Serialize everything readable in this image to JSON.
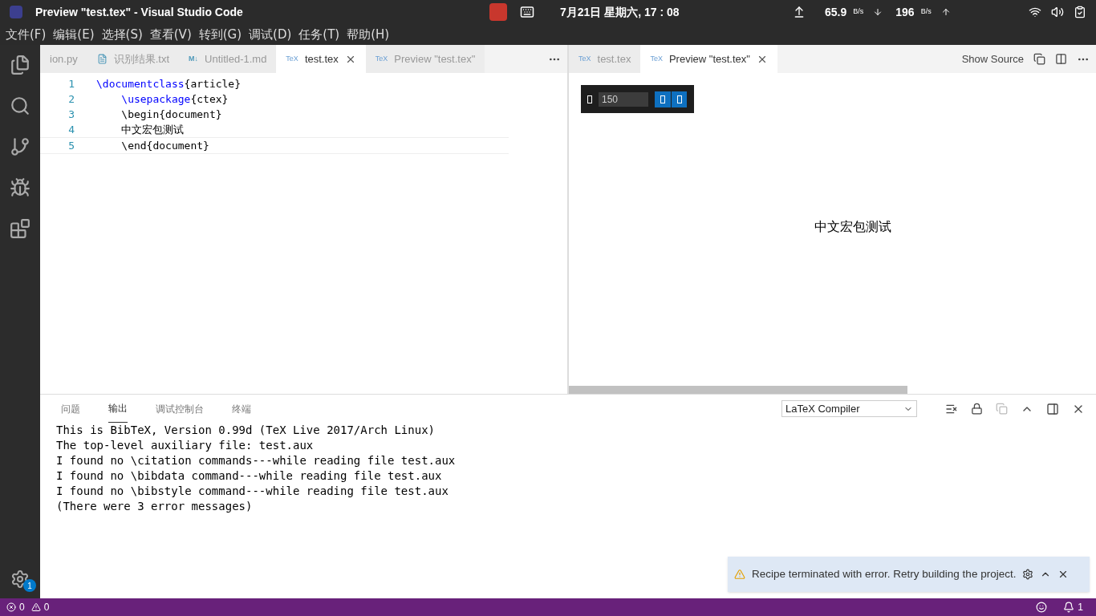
{
  "top_bar": {
    "title": "Preview \"test.tex\" - Visual Studio Code",
    "date": "7月21日 星期六, 17 : 08",
    "upload_speed": "65.9",
    "upload_unit": "B/s",
    "download_speed": "196",
    "download_unit": "B/s"
  },
  "menu": [
    "文件(F)",
    "编辑(E)",
    "选择(S)",
    "查看(V)",
    "转到(G)",
    "调试(D)",
    "任务(T)",
    "帮助(H)"
  ],
  "activity_bar": {
    "badge": "1"
  },
  "left_tabs": [
    {
      "label": "ion.py",
      "kind": "py",
      "selected": false,
      "close": false
    },
    {
      "label": "识别结果.txt",
      "kind": "txt",
      "selected": false,
      "close": false
    },
    {
      "label": "Untitled-1.md",
      "kind": "md",
      "icon": "M↓",
      "selected": false,
      "close": false
    },
    {
      "label": "test.tex",
      "kind": "tex",
      "icon": "TeX",
      "selected": true,
      "close": true
    },
    {
      "label": "Preview \"test.tex\"",
      "kind": "tex",
      "icon": "TeX",
      "selected": false,
      "close": false
    }
  ],
  "right_tabs": [
    {
      "label": "test.tex",
      "kind": "tex",
      "icon": "TeX",
      "selected": false,
      "close": false
    },
    {
      "label": "Preview \"test.tex\"",
      "kind": "tex",
      "icon": "TeX",
      "selected": true,
      "close": true
    }
  ],
  "show_source": "Show Source",
  "editor_lines": [
    {
      "number": "1",
      "parts": [
        {
          "text": "\\documentclass",
          "kind": "command"
        },
        {
          "text": "{article}",
          "kind": "plain"
        }
      ]
    },
    {
      "number": "2",
      "parts": [
        {
          "text": "    \\usepackage",
          "kind": "command"
        },
        {
          "text": "{ctex}",
          "kind": "plain"
        }
      ]
    },
    {
      "number": "3",
      "parts": [
        {
          "text": "    \\begin{document}",
          "kind": "plain"
        }
      ]
    },
    {
      "number": "4",
      "parts": [
        {
          "text": "    中文宏包测试",
          "kind": "plain"
        }
      ]
    },
    {
      "number": "5",
      "parts": [
        {
          "text": "    \\end{document}",
          "kind": "plain"
        }
      ]
    }
  ],
  "preview": {
    "zoom": "150",
    "text": "中文宏包测试"
  },
  "panel": {
    "tabs": [
      {
        "label": "问题",
        "selected": false
      },
      {
        "label": "输出",
        "selected": true
      },
      {
        "label": "调试控制台",
        "selected": false
      },
      {
        "label": "终端",
        "selected": false
      }
    ],
    "channel": "LaTeX Compiler",
    "output": [
      "This is BibTeX, Version 0.99d (TeX Live 2017/Arch Linux)",
      "The top-level auxiliary file: test.aux",
      "I found no \\citation commands---while reading file test.aux",
      "I found no \\bibdata command---while reading file test.aux",
      "I found no \\bibstyle command---while reading file test.aux",
      "(There were 3 error messages)"
    ]
  },
  "notification": {
    "message": "Recipe terminated with error. Retry building the project."
  },
  "status_bar": {
    "errors": "0",
    "warnings": "0",
    "notifications": "1"
  }
}
